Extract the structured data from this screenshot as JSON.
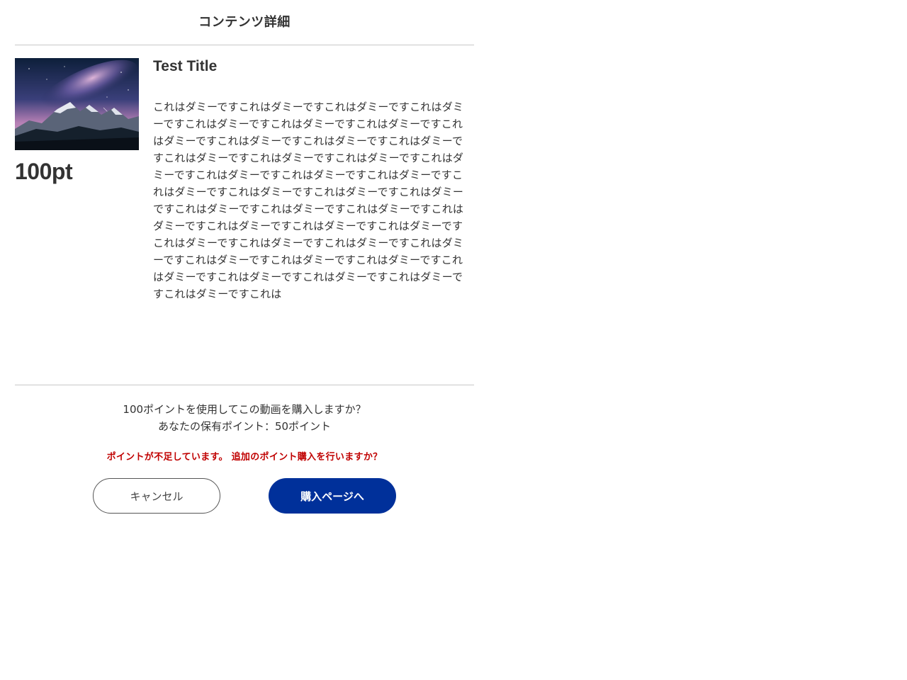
{
  "header": {
    "title": "コンテンツ詳細"
  },
  "content": {
    "thumbnail_icon": "mountain-night-sky-image",
    "price": "100pt",
    "title": "Test Title",
    "description": "これはダミーですこれはダミーですこれはダミーですこれはダミーですこれはダミーですこれはダミーですこれはダミーですこれはダミーですこれはダミーですこれはダミーですこれはダミーですこれはダミーですこれはダミーですこれはダミーですこれはダミーですこれはダミーですこれはダミーですこれはダミーですこれはダミーですこれはダミーですこれはダミーですこれはダミーですこれはダミーですこれはダミーですこれはダミーですこれはダミーですこれはダミーですこれはダミーですこれはダミーですこれはダミーですこれはダミーですこれはダミーですこれはダミーですこれはダミーですこれはダミーですこれはダミーですこれはダミーですこれはダミーですこれはダミーですこれはダミーですこれはダミーですこれは"
  },
  "purchase": {
    "question": "100ポイントを使用してこの動画を購入しますか？",
    "balance": "あなたの保有ポイント：50ポイント",
    "warning": "ポイントが不足しています。 追加のポイント購入を行いますか？",
    "cancel_label": "キャンセル",
    "buy_label": "購入ページへ"
  },
  "colors": {
    "primary": "#00309a",
    "warning": "#c00000",
    "divider": "#c8c8c8"
  }
}
